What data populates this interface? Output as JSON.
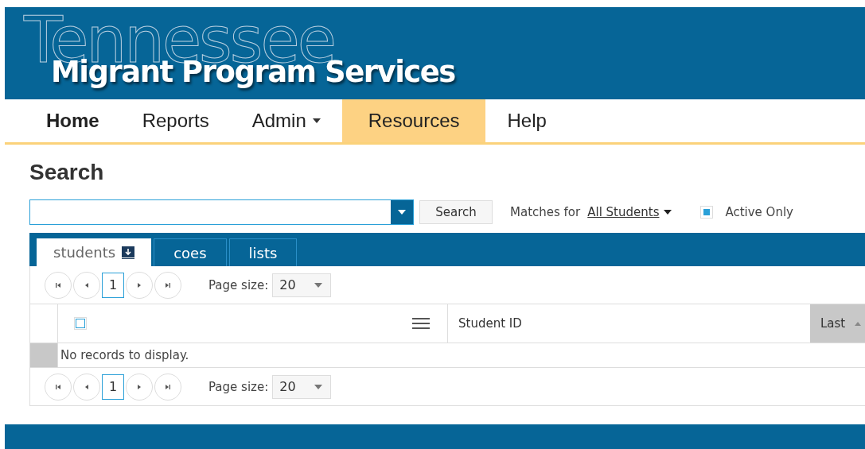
{
  "header": {
    "state_name": "Tennessee",
    "title": "Migrant Program Services"
  },
  "nav": [
    {
      "label": "Home",
      "selected": true,
      "highlighted": false,
      "kind": "link"
    },
    {
      "label": "Reports",
      "selected": false,
      "highlighted": false,
      "kind": "link"
    },
    {
      "label": "Admin",
      "selected": false,
      "highlighted": false,
      "kind": "dropdown"
    },
    {
      "label": "Resources",
      "selected": false,
      "highlighted": true,
      "kind": "link"
    },
    {
      "label": "Help",
      "selected": false,
      "highlighted": false,
      "kind": "link"
    }
  ],
  "page_title": "Search",
  "search": {
    "button": "Search",
    "matches_label": "Matches for",
    "matches_value": "All Students",
    "active_only": {
      "label": "Active Only",
      "checked": true
    }
  },
  "tabs": [
    {
      "label": "students",
      "selected": true,
      "download": true
    },
    {
      "label": "coes",
      "selected": false,
      "download": false
    },
    {
      "label": "lists",
      "selected": false,
      "download": false
    }
  ],
  "pager_top": {
    "page": "1",
    "page_size_label": "Page size:",
    "page_size": "20"
  },
  "table": {
    "select_all": {
      "checked": false
    },
    "columns": [
      "Student ID",
      "Last"
    ],
    "empty_message": "No records to display."
  },
  "pager_bottom": {
    "page": "1",
    "page_size_label": "Page size:",
    "page_size": "20"
  }
}
